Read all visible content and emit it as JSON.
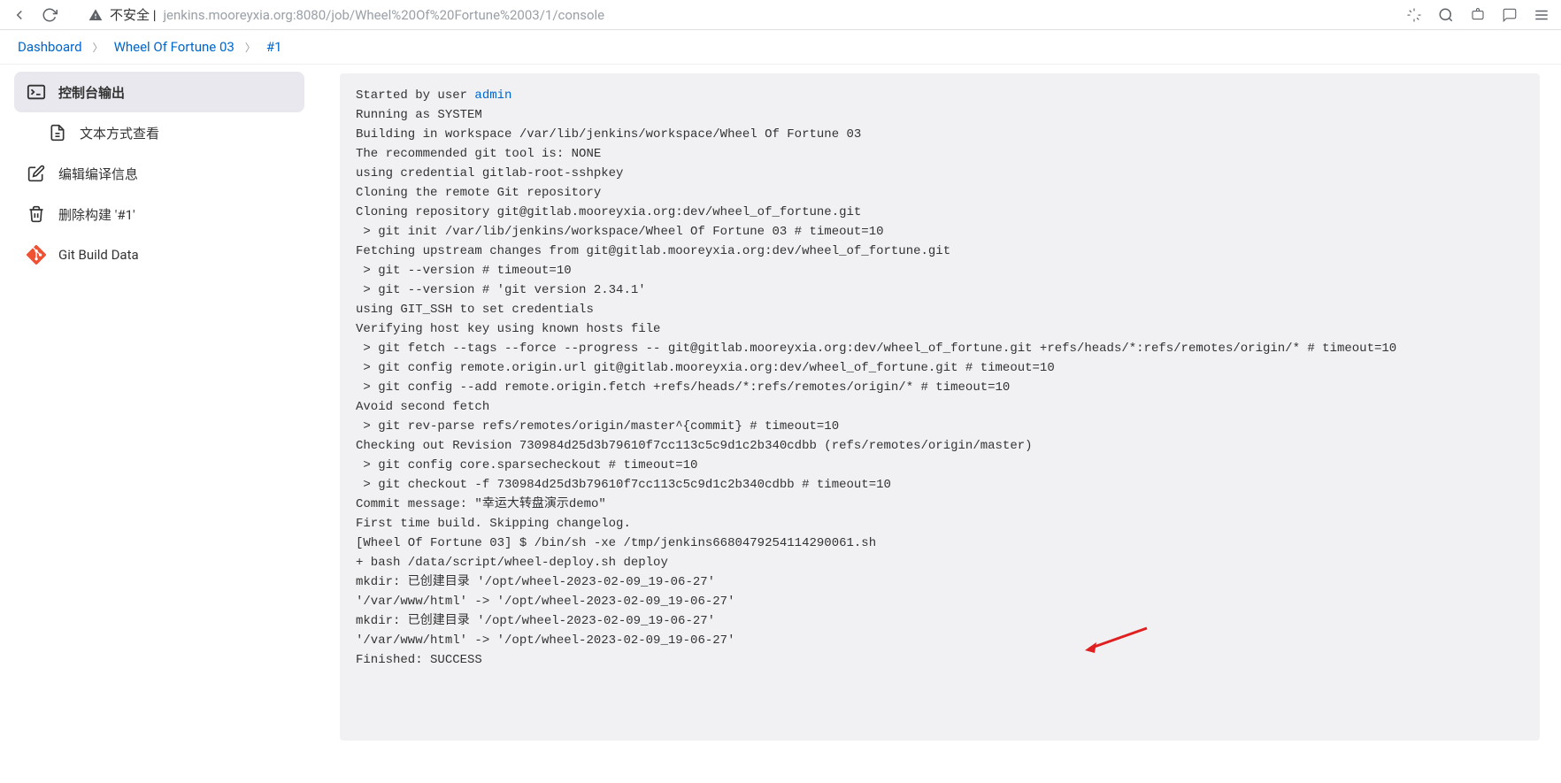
{
  "browser": {
    "url_prefix": "不安全 | ",
    "url": "jenkins.mooreyxia.org:8080/job/Wheel%20Of%20Fortune%2003/1/console"
  },
  "breadcrumb": {
    "items": [
      "Dashboard",
      "Wheel Of Fortune 03",
      "#1"
    ]
  },
  "sidebar": {
    "items": [
      {
        "label": "控制台输出",
        "icon": "terminal",
        "active": true
      },
      {
        "label": "文本方式查看",
        "icon": "document",
        "indent": true
      },
      {
        "label": "编辑编译信息",
        "icon": "edit"
      },
      {
        "label": "删除构建 '#1'",
        "icon": "trash"
      },
      {
        "label": "Git Build Data",
        "icon": "git"
      }
    ]
  },
  "console": {
    "started_by_prefix": "Started by user ",
    "started_by_user": "admin",
    "lines": [
      "Running as SYSTEM",
      "Building in workspace /var/lib/jenkins/workspace/Wheel Of Fortune 03",
      "The recommended git tool is: NONE",
      "using credential gitlab-root-sshpkey",
      "Cloning the remote Git repository",
      "Cloning repository git@gitlab.mooreyxia.org:dev/wheel_of_fortune.git",
      " > git init /var/lib/jenkins/workspace/Wheel Of Fortune 03 # timeout=10",
      "Fetching upstream changes from git@gitlab.mooreyxia.org:dev/wheel_of_fortune.git",
      " > git --version # timeout=10",
      " > git --version # 'git version 2.34.1'",
      "using GIT_SSH to set credentials ",
      "Verifying host key using known hosts file",
      " > git fetch --tags --force --progress -- git@gitlab.mooreyxia.org:dev/wheel_of_fortune.git +refs/heads/*:refs/remotes/origin/* # timeout=10",
      " > git config remote.origin.url git@gitlab.mooreyxia.org:dev/wheel_of_fortune.git # timeout=10",
      " > git config --add remote.origin.fetch +refs/heads/*:refs/remotes/origin/* # timeout=10",
      "Avoid second fetch",
      " > git rev-parse refs/remotes/origin/master^{commit} # timeout=10",
      "Checking out Revision 730984d25d3b79610f7cc113c5c9d1c2b340cdbb (refs/remotes/origin/master)",
      " > git config core.sparsecheckout # timeout=10",
      " > git checkout -f 730984d25d3b79610f7cc113c5c9d1c2b340cdbb # timeout=10",
      "Commit message: \"幸运大转盘演示demo\"",
      "First time build. Skipping changelog.",
      "[Wheel Of Fortune 03] $ /bin/sh -xe /tmp/jenkins6680479254114290061.sh",
      "+ bash /data/script/wheel-deploy.sh deploy",
      "mkdir: 已创建目录 '/opt/wheel-2023-02-09_19-06-27'",
      "'/var/www/html' -> '/opt/wheel-2023-02-09_19-06-27'",
      "mkdir: 已创建目录 '/opt/wheel-2023-02-09_19-06-27'",
      "'/var/www/html' -> '/opt/wheel-2023-02-09_19-06-27'",
      "Finished: SUCCESS"
    ]
  }
}
